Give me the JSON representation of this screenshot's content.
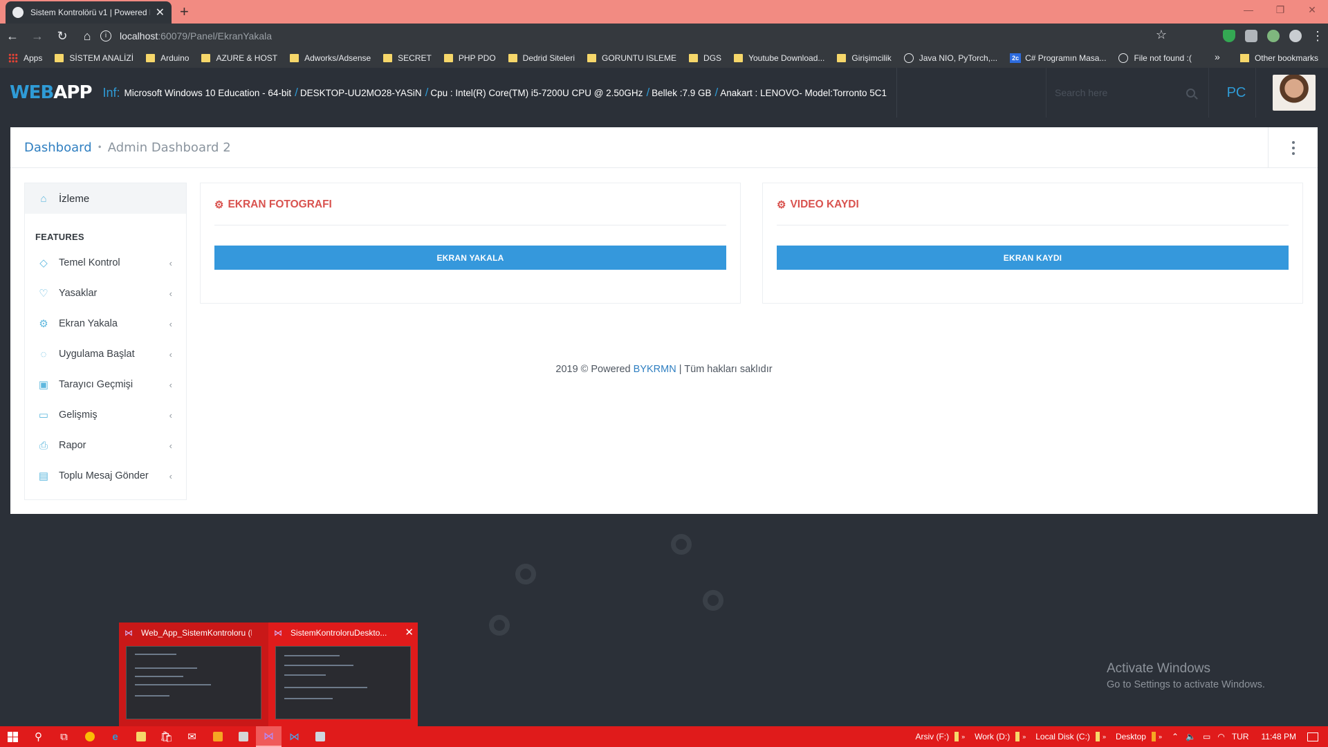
{
  "browser": {
    "tab_title": "Sistem Kontrolörü v1 | Powered B",
    "tab_close": "✕",
    "new_tab": "+",
    "url_host": "localhost",
    "url_path": ":60079/Panel/EkranYakala",
    "bookmarks": [
      {
        "label": "Apps",
        "icon": "apps-grid-icon"
      },
      {
        "label": "SİSTEM ANALİZİ",
        "icon": "folder-icon"
      },
      {
        "label": "Arduino",
        "icon": "folder-icon"
      },
      {
        "label": "AZURE & HOST",
        "icon": "folder-icon"
      },
      {
        "label": "Adworks/Adsense",
        "icon": "folder-icon"
      },
      {
        "label": "SECRET",
        "icon": "folder-icon"
      },
      {
        "label": "PHP PDO",
        "icon": "folder-icon"
      },
      {
        "label": "Dedrid Siteleri",
        "icon": "folder-icon"
      },
      {
        "label": "GORUNTU ISLEME",
        "icon": "folder-icon"
      },
      {
        "label": "DGS",
        "icon": "folder-icon"
      },
      {
        "label": "Youtube Download...",
        "icon": "folder-icon"
      },
      {
        "label": "Girişimcilik",
        "icon": "folder-icon"
      },
      {
        "label": "Java NIO, PyTorch,...",
        "icon": "site-icon"
      },
      {
        "label": "C# Programın Masa...",
        "icon": "2c-icon"
      },
      {
        "label": "File not found :(",
        "icon": "globe-icon"
      }
    ],
    "more_bookmarks": "»",
    "other_bookmarks": "Other bookmarks"
  },
  "app": {
    "logo_web": "WEB",
    "logo_app": "APP",
    "inf_label": "Inf:",
    "os": "Microsoft Windows 10 Education - 64-bit",
    "machine": "DESKTOP-UU2MO28-YASiN",
    "cpu": "Cpu : Intel(R) Core(TM) i5-7200U CPU @ 2.50GHz",
    "memory": "Bellek :7.9 GB",
    "motherboard": "Anakart : LENOVO- Model:Torronto 5C1",
    "search_placeholder": "Search here",
    "pc_label": "PC"
  },
  "breadcrumb": {
    "link": "Dashboard",
    "separator": "•",
    "current": "Admin Dashboard 2"
  },
  "sidebar": {
    "home_label": "İzleme",
    "section_title": "FEATURES",
    "items": [
      {
        "label": "Temel Kontrol",
        "icon": "diamond-icon"
      },
      {
        "label": "Yasaklar",
        "icon": "handshake-icon"
      },
      {
        "label": "Ekran Yakala",
        "icon": "gear-icon"
      },
      {
        "label": "Uygulama Başlat",
        "icon": "bulb-icon"
      },
      {
        "label": "Tarayıcı Geçmişi",
        "icon": "briefcase-icon"
      },
      {
        "label": "Gelişmiş",
        "icon": "folder-icon"
      },
      {
        "label": "Rapor",
        "icon": "printer-icon"
      },
      {
        "label": "Toplu Mesaj Gönder",
        "icon": "message-icon"
      }
    ],
    "chevron": "‹"
  },
  "cards": {
    "screenshot": {
      "title": "EKRAN FOTOGRAFI",
      "button": "EKRAN YAKALA"
    },
    "video": {
      "title": "VIDEO KAYDI",
      "button": "EKRAN KAYDI"
    }
  },
  "footer": {
    "prefix": "2019 © Powered",
    "brand": "BYKRMN",
    "suffix": "| Tüm hakları saklıdır"
  },
  "watermark": {
    "line1": "Activate Windows",
    "line2": "Go to Settings to activate Windows."
  },
  "thumbnails": [
    {
      "title": "Web_App_SistemKontroloru (R..."
    },
    {
      "title": "SistemKontroloruDeskto..."
    }
  ],
  "taskbar": {
    "drives": [
      "Arsiv (F:)",
      "Work (D:)",
      "Local Disk (C:)",
      "Desktop"
    ],
    "language": "TUR",
    "time": "11:48 PM"
  },
  "colors": {
    "accent_blue": "#3598dc",
    "title_red": "#d9534f",
    "taskbar_red": "#e01b1b",
    "header_dark": "#2b3038"
  }
}
